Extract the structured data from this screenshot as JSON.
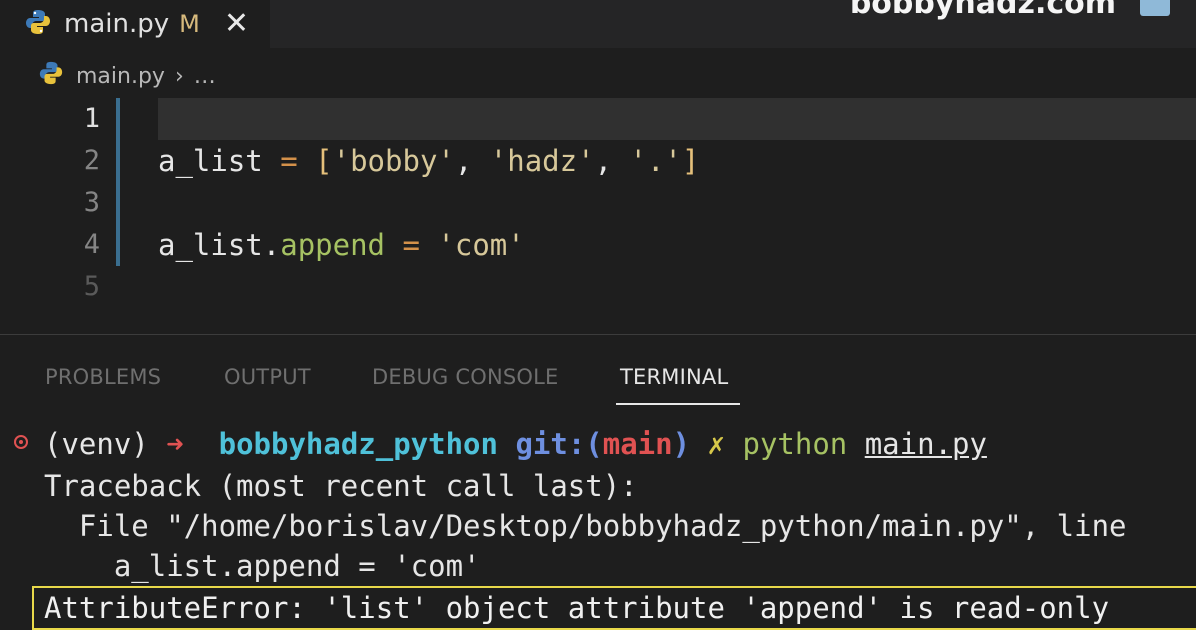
{
  "tab": {
    "filename": "main.py",
    "status": "M",
    "close": "✕"
  },
  "watermark": {
    "text": "bobbyhadz.com"
  },
  "breadcrumb": {
    "file": "main.py",
    "sep": "›",
    "more": "…"
  },
  "editor": {
    "line_numbers": [
      "1",
      "2",
      "3",
      "4",
      "5"
    ],
    "line2": {
      "var": "a_list",
      "eq": "=",
      "open": "[",
      "s1": "'bobby'",
      "c1": ",",
      "s2": "'hadz'",
      "c2": ",",
      "s3": "'.'",
      "close": "]"
    },
    "line4": {
      "obj": "a_list",
      "dot": ".",
      "attr": "append",
      "eq": "=",
      "val": "'com'"
    }
  },
  "panel_tabs": [
    "PROBLEMS",
    "OUTPUT",
    "DEBUG CONSOLE",
    "TERMINAL"
  ],
  "terminal": {
    "prompt": {
      "venv": "(venv)",
      "arrow": "➜",
      "dir": "bobbyhadz_python",
      "git": "git:(",
      "branch": "main",
      "git_close": ")",
      "dirty": "✗",
      "cmd": "python",
      "arg": "main.py"
    },
    "traceback": "Traceback (most recent call last):",
    "file_line": "  File \"/home/borislav/Desktop/bobbyhadz_python/main.py\", line",
    "code_line": "    a_list.append = 'com'",
    "error": "AttributeError: 'list' object attribute 'append' is read-only"
  },
  "colors": {
    "background": "#1e1e1e",
    "error_box": "#e8d94a",
    "active_tab_underline": "#e7e7e7"
  }
}
